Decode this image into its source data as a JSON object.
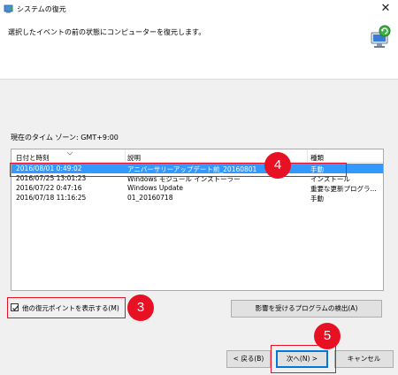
{
  "window": {
    "title": "システムの復元",
    "close_glyph": "✕"
  },
  "header": {
    "instruction": "選択したイベントの前の状態にコンピューターを復元します。"
  },
  "timezone": {
    "label": "現在のタイム ゾーン: GMT+9:00"
  },
  "restore_list": {
    "columns": [
      "日付と時刻",
      "説明",
      "種類"
    ],
    "rows": [
      {
        "date": "2016/08/01 0:49:02",
        "description": "アニバーサリーアップデート前_20160801",
        "type": "手動",
        "selected": true
      },
      {
        "date": "2016/07/25 13:01:23",
        "description": "Windows モジュール インストーラー",
        "type": "インストール",
        "selected": false
      },
      {
        "date": "2016/07/22 0:47:16",
        "description": "Windows Update",
        "type": "重要な更新プログラ...",
        "selected": false
      },
      {
        "date": "2016/07/18 11:16:25",
        "description": "01_20160718",
        "type": "手動",
        "selected": false
      }
    ],
    "selected_color": "#3399ff"
  },
  "options": {
    "show_more_label": "他の復元ポイントを表示する(M)",
    "show_more_checked": true
  },
  "buttons": {
    "affected_programs": "影響を受けるプログラムの検出(A)",
    "back": "< 戻る(B)",
    "next": "次へ(N) >",
    "cancel": "キャンセル"
  },
  "annotations": {
    "callout_row": "4",
    "callout_checkbox": "3",
    "callout_next": "5",
    "color": "#e81123"
  },
  "icons": {
    "app": "system-restore-icon",
    "header": "computer-restore-icon"
  }
}
